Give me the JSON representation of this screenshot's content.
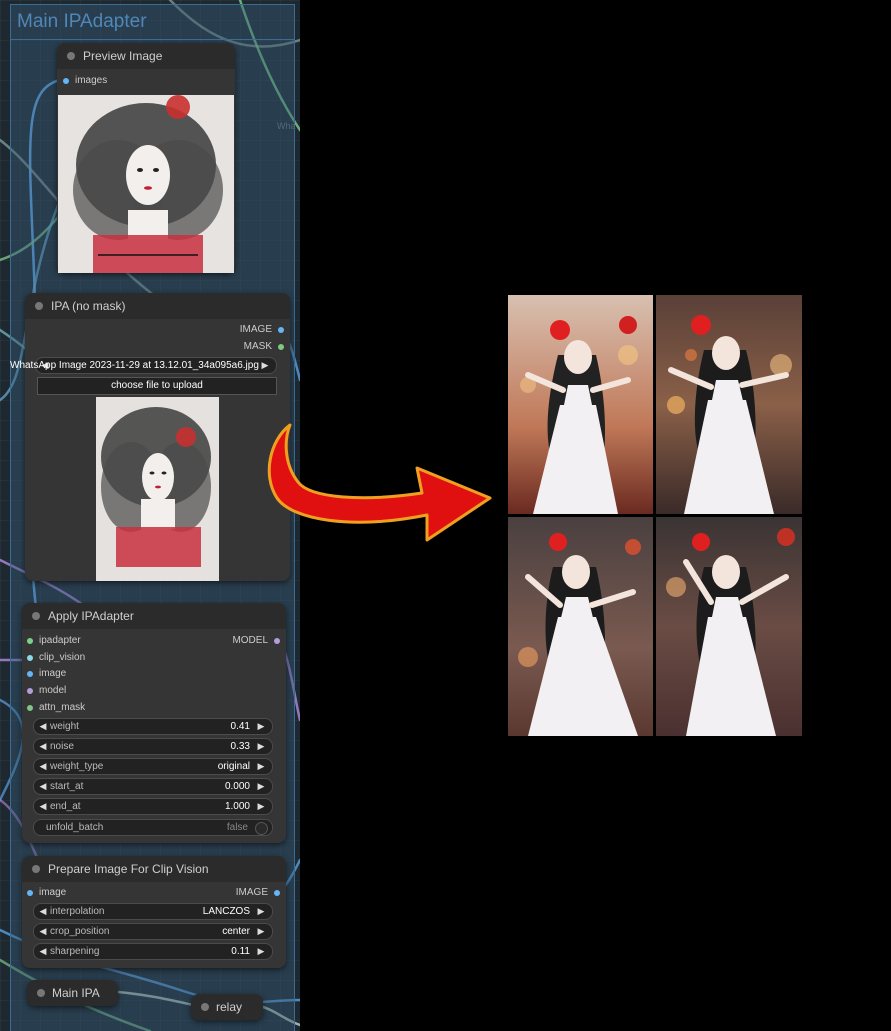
{
  "group": {
    "title": "Main IPAdapter"
  },
  "canvas_text": {
    "faded_label": "Wha"
  },
  "preview_node": {
    "title": "Preview Image",
    "input_images": "images",
    "image_alt": "ink sketch portrait of woman with red accent"
  },
  "ipa_node": {
    "title": "IPA (no mask)",
    "output_image": "IMAGE",
    "output_mask": "MASK",
    "image_select": "WhatsApp Image 2023-11-29 at 13.12.01_34a095a6.jpg",
    "upload_label": "choose file to upload"
  },
  "apply_node": {
    "title": "Apply IPAdapter",
    "output_model": "MODEL",
    "inputs": [
      "ipadapter",
      "clip_vision",
      "image",
      "model",
      "attn_mask"
    ],
    "widgets": {
      "weight": {
        "label": "weight",
        "value": "0.41"
      },
      "noise": {
        "label": "noise",
        "value": "0.33"
      },
      "weight_type": {
        "label": "weight_type",
        "value": "original"
      },
      "start_at": {
        "label": "start_at",
        "value": "0.000"
      },
      "end_at": {
        "label": "end_at",
        "value": "1.000"
      },
      "unfold_batch": {
        "label": "unfold_batch",
        "value": "false"
      }
    }
  },
  "prep_node": {
    "title": "Prepare Image For Clip Vision",
    "input_image": "image",
    "output_image": "IMAGE",
    "widgets": {
      "interpolation": {
        "label": "interpolation",
        "value": "LANCZOS"
      },
      "crop_position": {
        "label": "crop_position",
        "value": "center"
      },
      "sharpening": {
        "label": "sharpening",
        "value": "0.11"
      }
    }
  },
  "collapsed_nodes": {
    "main_ipa": "Main IPA",
    "relay": "relay"
  },
  "colors": {
    "canvas": "#1e2830",
    "group_fill": "#375a78",
    "group_title": "#4f87b8",
    "node_body": "#353535",
    "image_slot": "#64b5f6",
    "mask_slot": "#81c784",
    "model_slot": "#b39ddb",
    "arrow_red": "#e01010",
    "arrow_outline": "#f0a020"
  },
  "output_grid": {
    "description_icon": "generated-image-grid-icon"
  }
}
